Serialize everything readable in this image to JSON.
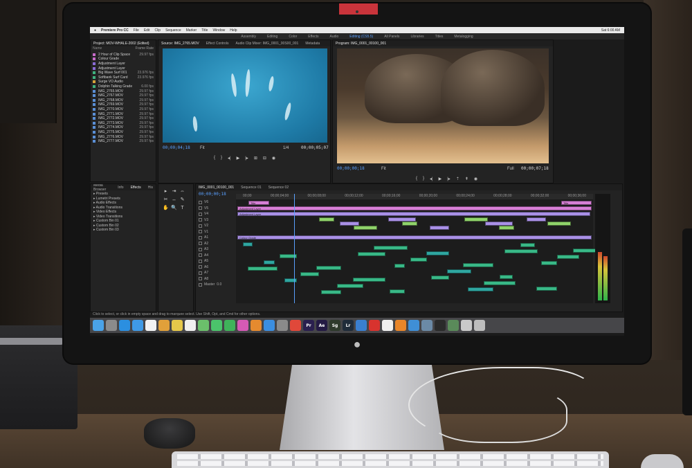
{
  "menubar": {
    "app_name": "Premiere Pro CC",
    "items": [
      "File",
      "Edit",
      "Clip",
      "Sequence",
      "Marker",
      "Title",
      "Window",
      "Help"
    ],
    "clock": "Sat 6:00 AM"
  },
  "workspaces": {
    "items": [
      "Assembly",
      "Editing",
      "Color",
      "Effects",
      "Audio",
      "Editing (CS5.5)",
      "All Panels",
      "Libraries",
      "Titles",
      "Metalogging"
    ],
    "active_index": 5
  },
  "project_panel": {
    "tabs": [
      "Project: MOV-WHALE-2002 (Edited)",
      "Media Browser"
    ],
    "header_name": "Name",
    "header_fps": "Frame Rate",
    "items": [
      {
        "name": "2 Hour of Clip Space",
        "fps": "29.97 fps",
        "color": "#c66bc9"
      },
      {
        "name": "Colour Grade",
        "fps": "",
        "color": "#c66bc9"
      },
      {
        "name": "Adjustment Layer",
        "fps": "",
        "color": "#8a6bd6"
      },
      {
        "name": "Adjustment Layer",
        "fps": "",
        "color": "#8a6bd6"
      },
      {
        "name": "Big Wave Surf 001",
        "fps": "23.976 fps",
        "color": "#3fb37f"
      },
      {
        "name": "Softbank Surf Card",
        "fps": "23.976 fps",
        "color": "#3fb37f"
      },
      {
        "name": "Surge VO Audio",
        "fps": "",
        "color": "#d7a33a"
      },
      {
        "name": "Dolphin Talking Grade",
        "fps": "6.00 fps",
        "color": "#3fb37f"
      },
      {
        "name": "IMG_2765.MOV",
        "fps": "29.97 fps",
        "color": "#5a8fd6"
      },
      {
        "name": "IMG_2767.MOV",
        "fps": "29.97 fps",
        "color": "#5a8fd6"
      },
      {
        "name": "IMG_2768.MOV",
        "fps": "29.97 fps",
        "color": "#5a8fd6"
      },
      {
        "name": "IMG_2769.MOV",
        "fps": "29.97 fps",
        "color": "#5a8fd6"
      },
      {
        "name": "IMG_2770.MOV",
        "fps": "29.97 fps",
        "color": "#5a8fd6"
      },
      {
        "name": "IMG_2771.MOV",
        "fps": "29.97 fps",
        "color": "#5a8fd6"
      },
      {
        "name": "IMG_2772.MOV",
        "fps": "29.97 fps",
        "color": "#5a8fd6"
      },
      {
        "name": "IMG_2773.MOV",
        "fps": "29.97 fps",
        "color": "#5a8fd6"
      },
      {
        "name": "IMG_2774.MOV",
        "fps": "29.97 fps",
        "color": "#5a8fd6"
      },
      {
        "name": "IMG_2775.MOV",
        "fps": "29.97 fps",
        "color": "#5a8fd6"
      },
      {
        "name": "IMG_2776.MOV",
        "fps": "29.97 fps",
        "color": "#5a8fd6"
      },
      {
        "name": "IMG_2777.MOV",
        "fps": "29.97 fps",
        "color": "#5a8fd6"
      }
    ]
  },
  "source_monitor": {
    "tabs": [
      "Source: IMG_2765.MOV",
      "Effect Controls",
      "Audio Clip Mixer: IMG_0001_00S00_001",
      "Metadata"
    ],
    "timecode_left": "00;00;04;18",
    "fit": "Fit",
    "scale": "1/4",
    "timecode_right": "00;00;05;07"
  },
  "program_monitor": {
    "tabs": [
      "Program: IMG_0001_00100_001"
    ],
    "timecode_left": "00;00;00;18",
    "fit": "Fit",
    "scale": "Full",
    "timecode_right": "00;00;07;18"
  },
  "effects_panel": {
    "tabs": [
      "Media Browser",
      "Info",
      "Effects",
      "His"
    ],
    "active_index": 2,
    "items": [
      "Presets",
      "Lumetri Presets",
      "Audio Effects",
      "Audio Transitions",
      "Video Effects",
      "Video Transitions",
      "Custom Bin 01",
      "Custom Bin 02",
      "Custom Bin 03"
    ]
  },
  "tools": [
    "▸",
    "⇥",
    "⇔",
    "✂",
    "↔",
    "✎",
    "✋",
    "🔍",
    "T"
  ],
  "timeline": {
    "tabs": [
      "IMG_0001_00100_001",
      "Sequence 01",
      "Sequence 02"
    ],
    "timecode": "00;00;00;18",
    "ruler": [
      "00;00",
      "00;00;04;00",
      "00;00;08;00",
      "00;00;12;00",
      "00;00;16;00",
      "00;00;20;00",
      "00;00;24;00",
      "00;00;28;00",
      "00;00;32;00",
      "00;00;36;00"
    ],
    "tracks": [
      "V6",
      "V5",
      "V4",
      "V3",
      "V2",
      "V1",
      "A1",
      "A2",
      "A3",
      "A4",
      "A5",
      "A6",
      "A7",
      "A8",
      "Master"
    ],
    "master_value": "0.0",
    "clip_labels": {
      "title": "Title",
      "adjustment": "Adjustment Layer",
      "colour": "Colour Grade"
    }
  },
  "status": {
    "hint": "Click to select, or click in empty space and drag to marquee select. Use Shift, Opt, and Cmd for other options."
  },
  "dock": {
    "icons": [
      {
        "name": "finder-icon",
        "label": "",
        "color": "#4aa3e8"
      },
      {
        "name": "launchpad-icon",
        "label": "",
        "color": "#8b8b8b"
      },
      {
        "name": "safari-icon",
        "label": "",
        "color": "#2b8fe0"
      },
      {
        "name": "mail-icon",
        "label": "",
        "color": "#3f9ae6"
      },
      {
        "name": "calendar-icon",
        "label": "",
        "color": "#f2f2f2"
      },
      {
        "name": "photos-icon",
        "label": "",
        "color": "#e1a03a"
      },
      {
        "name": "notes-icon",
        "label": "",
        "color": "#e6c84a"
      },
      {
        "name": "reminders-icon",
        "label": "",
        "color": "#f0f0f0"
      },
      {
        "name": "maps-icon",
        "label": "",
        "color": "#6bbf6b"
      },
      {
        "name": "messages-icon",
        "label": "",
        "color": "#4bc36b"
      },
      {
        "name": "facetime-icon",
        "label": "",
        "color": "#3fb35a"
      },
      {
        "name": "itunes-icon",
        "label": "",
        "color": "#d55ab5"
      },
      {
        "name": "ibooks-icon",
        "label": "",
        "color": "#e58a2f"
      },
      {
        "name": "app-store-icon",
        "label": "",
        "color": "#3b8ee0"
      },
      {
        "name": "preferences-icon",
        "label": "",
        "color": "#8a8a8a"
      },
      {
        "name": "chrome-icon",
        "label": "",
        "color": "#e0483a"
      },
      {
        "name": "premiere-icon",
        "label": "Pr",
        "color": "#2a1f4f"
      },
      {
        "name": "after-effects-icon",
        "label": "Ae",
        "color": "#241a44"
      },
      {
        "name": "speedgrade-icon",
        "label": "Sg",
        "color": "#2e3a2b"
      },
      {
        "name": "lightroom-icon",
        "label": "Lr",
        "color": "#1f2c3a"
      },
      {
        "name": "cinema4d-icon",
        "label": "",
        "color": "#3a7fd0"
      },
      {
        "name": "creative-cloud-icon",
        "label": "",
        "color": "#d8332e"
      },
      {
        "name": "music-icon",
        "label": "",
        "color": "#f0f0f0"
      },
      {
        "name": "vlc-icon",
        "label": "",
        "color": "#e8862a"
      },
      {
        "name": "transmit-icon",
        "label": "",
        "color": "#3f8fd6"
      },
      {
        "name": "network-icon",
        "label": "",
        "color": "#6b8aa6"
      },
      {
        "name": "terminal-icon",
        "label": "",
        "color": "#2a2a2a"
      },
      {
        "name": "activity-icon",
        "label": "",
        "color": "#5a8a5a"
      },
      {
        "name": "downloads-icon",
        "label": "",
        "color": "#c9c9c9"
      },
      {
        "name": "trash-icon",
        "label": "",
        "color": "#bdbdbd"
      }
    ]
  },
  "colors": {
    "accent_blue": "#5aa0ff",
    "clip_pink": "#d77fd6",
    "clip_violet": "#a990e6",
    "clip_green": "#39b887"
  }
}
